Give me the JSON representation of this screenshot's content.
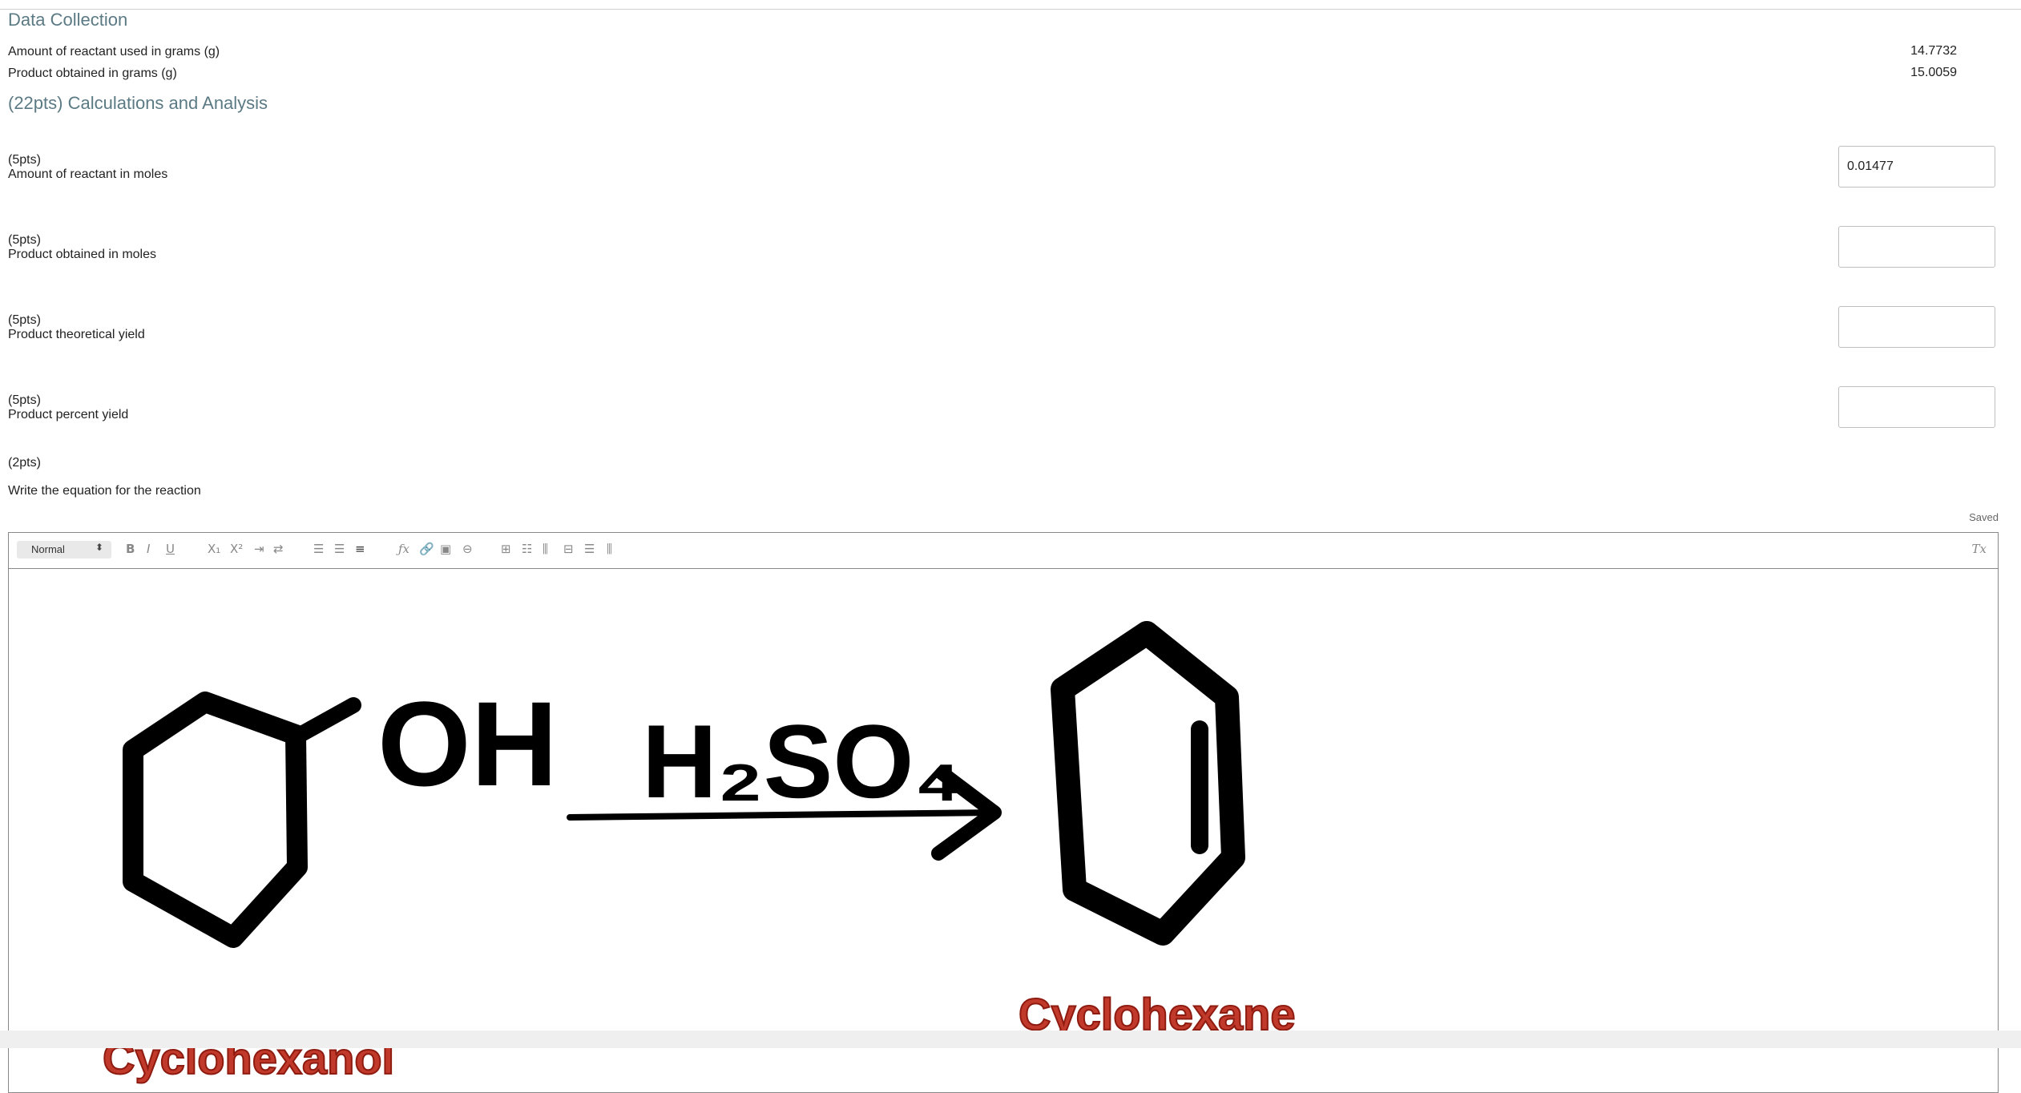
{
  "data_collection": {
    "title": "Data Collection",
    "rows": [
      {
        "label": "Amount of reactant used in grams (g)",
        "value": "14.7732"
      },
      {
        "label": "Product obtained in grams (g)",
        "value": "15.0059"
      }
    ]
  },
  "calculations": {
    "title": "(22pts) Calculations and Analysis",
    "questions": [
      {
        "points": "(5pts)",
        "label": "Amount of reactant in moles",
        "value": "0.01477"
      },
      {
        "points": "(5pts)",
        "label": "Product obtained in moles",
        "value": ""
      },
      {
        "points": "(5pts)",
        "label": "Product theoretical yield",
        "value": ""
      },
      {
        "points": "(5pts)",
        "label": "Product percent yield",
        "value": ""
      }
    ]
  },
  "equation": {
    "points": "(2pts)",
    "prompt": "Write the equation for the reaction",
    "status": "Saved",
    "format_select": "Normal",
    "toolbar_icons": [
      "bold-icon",
      "italic-icon",
      "underline-icon",
      "subscript-icon",
      "superscript-icon",
      "indent-icon",
      "direction-icon",
      "ordered-list-icon",
      "bullet-list-icon",
      "align-icon",
      "formula-icon",
      "link-icon",
      "image-icon",
      "embed-icon",
      "table-icon",
      "table-row-icon",
      "table-col-icon",
      "table-cell-icon",
      "table-delete-icon",
      "table-split-icon",
      "clear-format-icon"
    ],
    "drawing": {
      "reactant_label": "Cyclohexanol",
      "product_label": "Cyclohexane",
      "oh_text": "OH",
      "reagent": "H₂SO₄",
      "label_color": "#c0392b"
    }
  }
}
